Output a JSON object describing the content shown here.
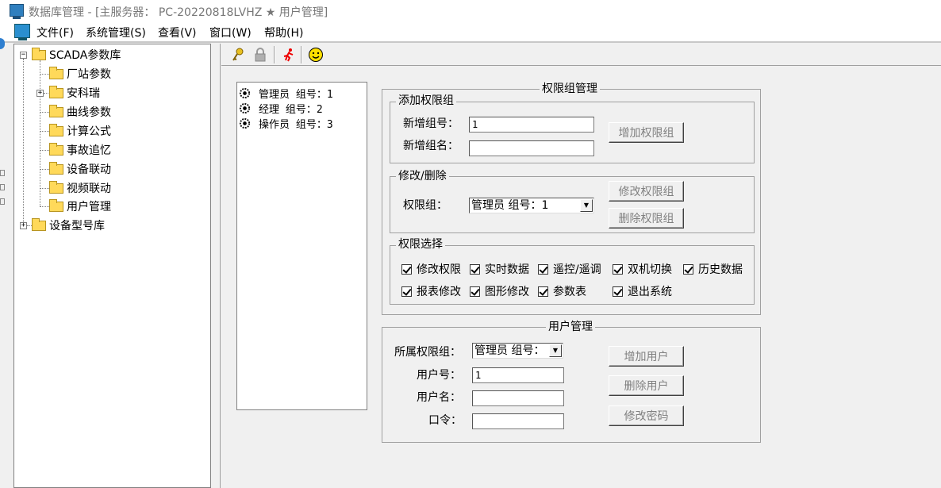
{
  "window": {
    "title": "数据库管理 - [主服务器： PC-20220818LVHZ ★ 用户管理]"
  },
  "menu": {
    "file": "文件(F)",
    "system": "系统管理(S)",
    "view": "查看(V)",
    "window": "窗口(W)",
    "help": "帮助(H)"
  },
  "tree": {
    "root": "SCADA参数库",
    "children": [
      "厂站参数",
      "安科瑞",
      "曲线参数",
      "计算公式",
      "事故追忆",
      "设备联动",
      "视频联动",
      "用户管理"
    ],
    "root2": "设备型号库"
  },
  "toolbar": {
    "icons": [
      "key-icon",
      "lock-icon",
      "runner-icon",
      "smiley-icon"
    ]
  },
  "group_list": {
    "items": [
      "管理员 组号：1",
      "经理 组号：2",
      "操作员 组号：3"
    ]
  },
  "perm_group_mgmt": {
    "title": "权限组管理",
    "add": {
      "title": "添加权限组",
      "new_id_label": "新增组号：",
      "new_id_value": "1",
      "new_name_label": "新增组名：",
      "new_name_value": "",
      "add_button": "增加权限组"
    },
    "modify": {
      "title": "修改/删除",
      "group_label": "权限组：",
      "group_selected": "管理员 组号：1",
      "modify_button": "修改权限组",
      "delete_button": "删除权限组"
    },
    "perms": {
      "title": "权限选择",
      "items": [
        {
          "label": "修改权限",
          "checked": true
        },
        {
          "label": "实时数据",
          "checked": true
        },
        {
          "label": "遥控/遥调",
          "checked": true
        },
        {
          "label": "双机切换",
          "checked": true
        },
        {
          "label": "历史数据",
          "checked": true
        },
        {
          "label": "报表修改",
          "checked": true
        },
        {
          "label": "图形修改",
          "checked": true
        },
        {
          "label": "参数表",
          "checked": true
        },
        {
          "label": "退出系统",
          "checked": true
        }
      ]
    }
  },
  "user_mgmt": {
    "title": "用户管理",
    "group_label": "所属权限组：",
    "group_selected": "管理员 组号：",
    "user_id_label": "用户号：",
    "user_id_value": "1",
    "user_name_label": "用户名：",
    "user_name_value": "",
    "password_label": "口令：",
    "password_value": "",
    "add_button": "增加用户",
    "delete_button": "删除用户",
    "change_password_button": "修改密码"
  }
}
